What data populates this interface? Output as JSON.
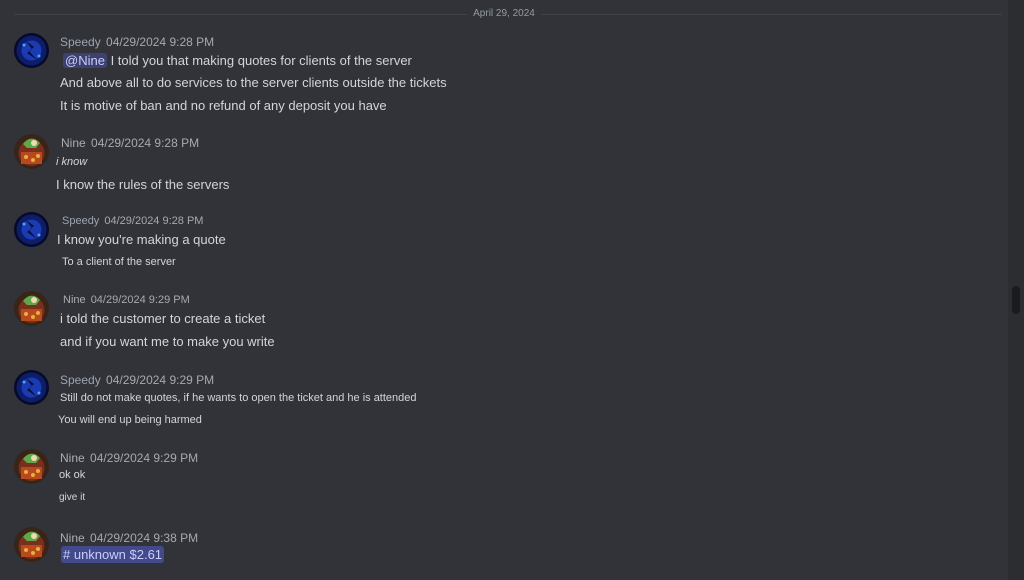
{
  "date_divider": "April 29, 2024",
  "messages": [
    {
      "user": "Speedy",
      "timestamp": "04/29/2024 9:28 PM",
      "avatar": "speedy-avatar",
      "mention": "@Nine",
      "lines": [
        "I told you that making quotes for clients of the server",
        "And above all to do services to the server clients outside the tickets",
        "It is motive of ban and no refund of any deposit you have"
      ]
    },
    {
      "user": "Nine",
      "timestamp": "04/29/2024 9:28 PM",
      "avatar": "nine-avatar",
      "lines": [
        "i know",
        "I know the rules of the servers"
      ]
    },
    {
      "user": "Speedy",
      "timestamp": "04/29/2024 9:28 PM",
      "avatar": "speedy-avatar",
      "lines": [
        "I know you're making a quote",
        "To a client of the server"
      ]
    },
    {
      "user": "Nine",
      "timestamp": "04/29/2024 9:29 PM",
      "avatar": "nine-avatar",
      "lines": [
        "i told the customer to create a ticket",
        "and if you want me to make you write"
      ]
    },
    {
      "user": "Speedy",
      "timestamp": "04/29/2024 9:29 PM",
      "avatar": "speedy-avatar",
      "lines": [
        "Still do not make quotes, if he wants to open the ticket and he is attended",
        "You will end up being harmed"
      ]
    },
    {
      "user": "Nine",
      "timestamp": "04/29/2024 9:29 PM",
      "avatar": "nine-avatar",
      "lines": [
        "ok ok",
        "give it"
      ]
    },
    {
      "user": "Nine",
      "timestamp": "04/29/2024 9:38 PM",
      "avatar": "nine-avatar",
      "channel": "# unknown $2.61"
    }
  ],
  "colors": {
    "background": "#313338",
    "text": "#dbdee1",
    "timestamp": "#a6a9af",
    "mention_bg": "#5865f2"
  }
}
